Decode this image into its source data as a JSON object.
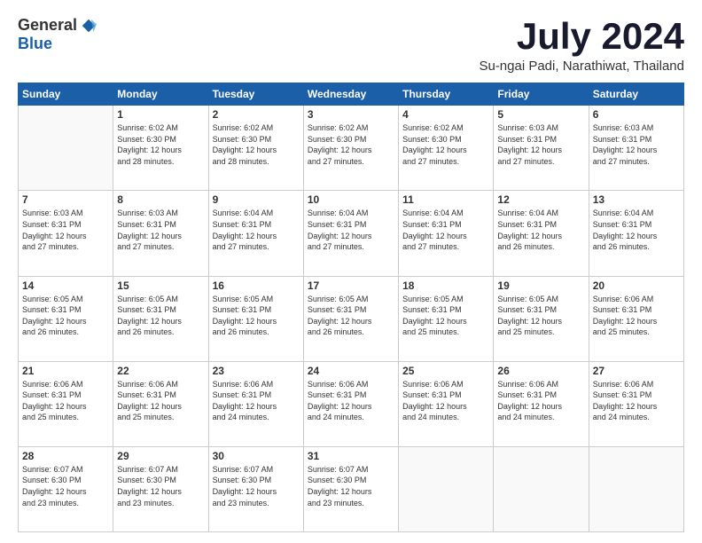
{
  "logo": {
    "general": "General",
    "blue": "Blue"
  },
  "title": "July 2024",
  "subtitle": "Su-ngai Padi, Narathiwat, Thailand",
  "days": [
    "Sunday",
    "Monday",
    "Tuesday",
    "Wednesday",
    "Thursday",
    "Friday",
    "Saturday"
  ],
  "weeks": [
    [
      {
        "day": "",
        "info": ""
      },
      {
        "day": "1",
        "info": "Sunrise: 6:02 AM\nSunset: 6:30 PM\nDaylight: 12 hours\nand 28 minutes."
      },
      {
        "day": "2",
        "info": "Sunrise: 6:02 AM\nSunset: 6:30 PM\nDaylight: 12 hours\nand 28 minutes."
      },
      {
        "day": "3",
        "info": "Sunrise: 6:02 AM\nSunset: 6:30 PM\nDaylight: 12 hours\nand 27 minutes."
      },
      {
        "day": "4",
        "info": "Sunrise: 6:02 AM\nSunset: 6:30 PM\nDaylight: 12 hours\nand 27 minutes."
      },
      {
        "day": "5",
        "info": "Sunrise: 6:03 AM\nSunset: 6:31 PM\nDaylight: 12 hours\nand 27 minutes."
      },
      {
        "day": "6",
        "info": "Sunrise: 6:03 AM\nSunset: 6:31 PM\nDaylight: 12 hours\nand 27 minutes."
      }
    ],
    [
      {
        "day": "7",
        "info": "Sunrise: 6:03 AM\nSunset: 6:31 PM\nDaylight: 12 hours\nand 27 minutes."
      },
      {
        "day": "8",
        "info": "Sunrise: 6:03 AM\nSunset: 6:31 PM\nDaylight: 12 hours\nand 27 minutes."
      },
      {
        "day": "9",
        "info": "Sunrise: 6:04 AM\nSunset: 6:31 PM\nDaylight: 12 hours\nand 27 minutes."
      },
      {
        "day": "10",
        "info": "Sunrise: 6:04 AM\nSunset: 6:31 PM\nDaylight: 12 hours\nand 27 minutes."
      },
      {
        "day": "11",
        "info": "Sunrise: 6:04 AM\nSunset: 6:31 PM\nDaylight: 12 hours\nand 27 minutes."
      },
      {
        "day": "12",
        "info": "Sunrise: 6:04 AM\nSunset: 6:31 PM\nDaylight: 12 hours\nand 26 minutes."
      },
      {
        "day": "13",
        "info": "Sunrise: 6:04 AM\nSunset: 6:31 PM\nDaylight: 12 hours\nand 26 minutes."
      }
    ],
    [
      {
        "day": "14",
        "info": "Sunrise: 6:05 AM\nSunset: 6:31 PM\nDaylight: 12 hours\nand 26 minutes."
      },
      {
        "day": "15",
        "info": "Sunrise: 6:05 AM\nSunset: 6:31 PM\nDaylight: 12 hours\nand 26 minutes."
      },
      {
        "day": "16",
        "info": "Sunrise: 6:05 AM\nSunset: 6:31 PM\nDaylight: 12 hours\nand 26 minutes."
      },
      {
        "day": "17",
        "info": "Sunrise: 6:05 AM\nSunset: 6:31 PM\nDaylight: 12 hours\nand 26 minutes."
      },
      {
        "day": "18",
        "info": "Sunrise: 6:05 AM\nSunset: 6:31 PM\nDaylight: 12 hours\nand 25 minutes."
      },
      {
        "day": "19",
        "info": "Sunrise: 6:05 AM\nSunset: 6:31 PM\nDaylight: 12 hours\nand 25 minutes."
      },
      {
        "day": "20",
        "info": "Sunrise: 6:06 AM\nSunset: 6:31 PM\nDaylight: 12 hours\nand 25 minutes."
      }
    ],
    [
      {
        "day": "21",
        "info": "Sunrise: 6:06 AM\nSunset: 6:31 PM\nDaylight: 12 hours\nand 25 minutes."
      },
      {
        "day": "22",
        "info": "Sunrise: 6:06 AM\nSunset: 6:31 PM\nDaylight: 12 hours\nand 25 minutes."
      },
      {
        "day": "23",
        "info": "Sunrise: 6:06 AM\nSunset: 6:31 PM\nDaylight: 12 hours\nand 24 minutes."
      },
      {
        "day": "24",
        "info": "Sunrise: 6:06 AM\nSunset: 6:31 PM\nDaylight: 12 hours\nand 24 minutes."
      },
      {
        "day": "25",
        "info": "Sunrise: 6:06 AM\nSunset: 6:31 PM\nDaylight: 12 hours\nand 24 minutes."
      },
      {
        "day": "26",
        "info": "Sunrise: 6:06 AM\nSunset: 6:31 PM\nDaylight: 12 hours\nand 24 minutes."
      },
      {
        "day": "27",
        "info": "Sunrise: 6:06 AM\nSunset: 6:31 PM\nDaylight: 12 hours\nand 24 minutes."
      }
    ],
    [
      {
        "day": "28",
        "info": "Sunrise: 6:07 AM\nSunset: 6:30 PM\nDaylight: 12 hours\nand 23 minutes."
      },
      {
        "day": "29",
        "info": "Sunrise: 6:07 AM\nSunset: 6:30 PM\nDaylight: 12 hours\nand 23 minutes."
      },
      {
        "day": "30",
        "info": "Sunrise: 6:07 AM\nSunset: 6:30 PM\nDaylight: 12 hours\nand 23 minutes."
      },
      {
        "day": "31",
        "info": "Sunrise: 6:07 AM\nSunset: 6:30 PM\nDaylight: 12 hours\nand 23 minutes."
      },
      {
        "day": "",
        "info": ""
      },
      {
        "day": "",
        "info": ""
      },
      {
        "day": "",
        "info": ""
      }
    ]
  ]
}
